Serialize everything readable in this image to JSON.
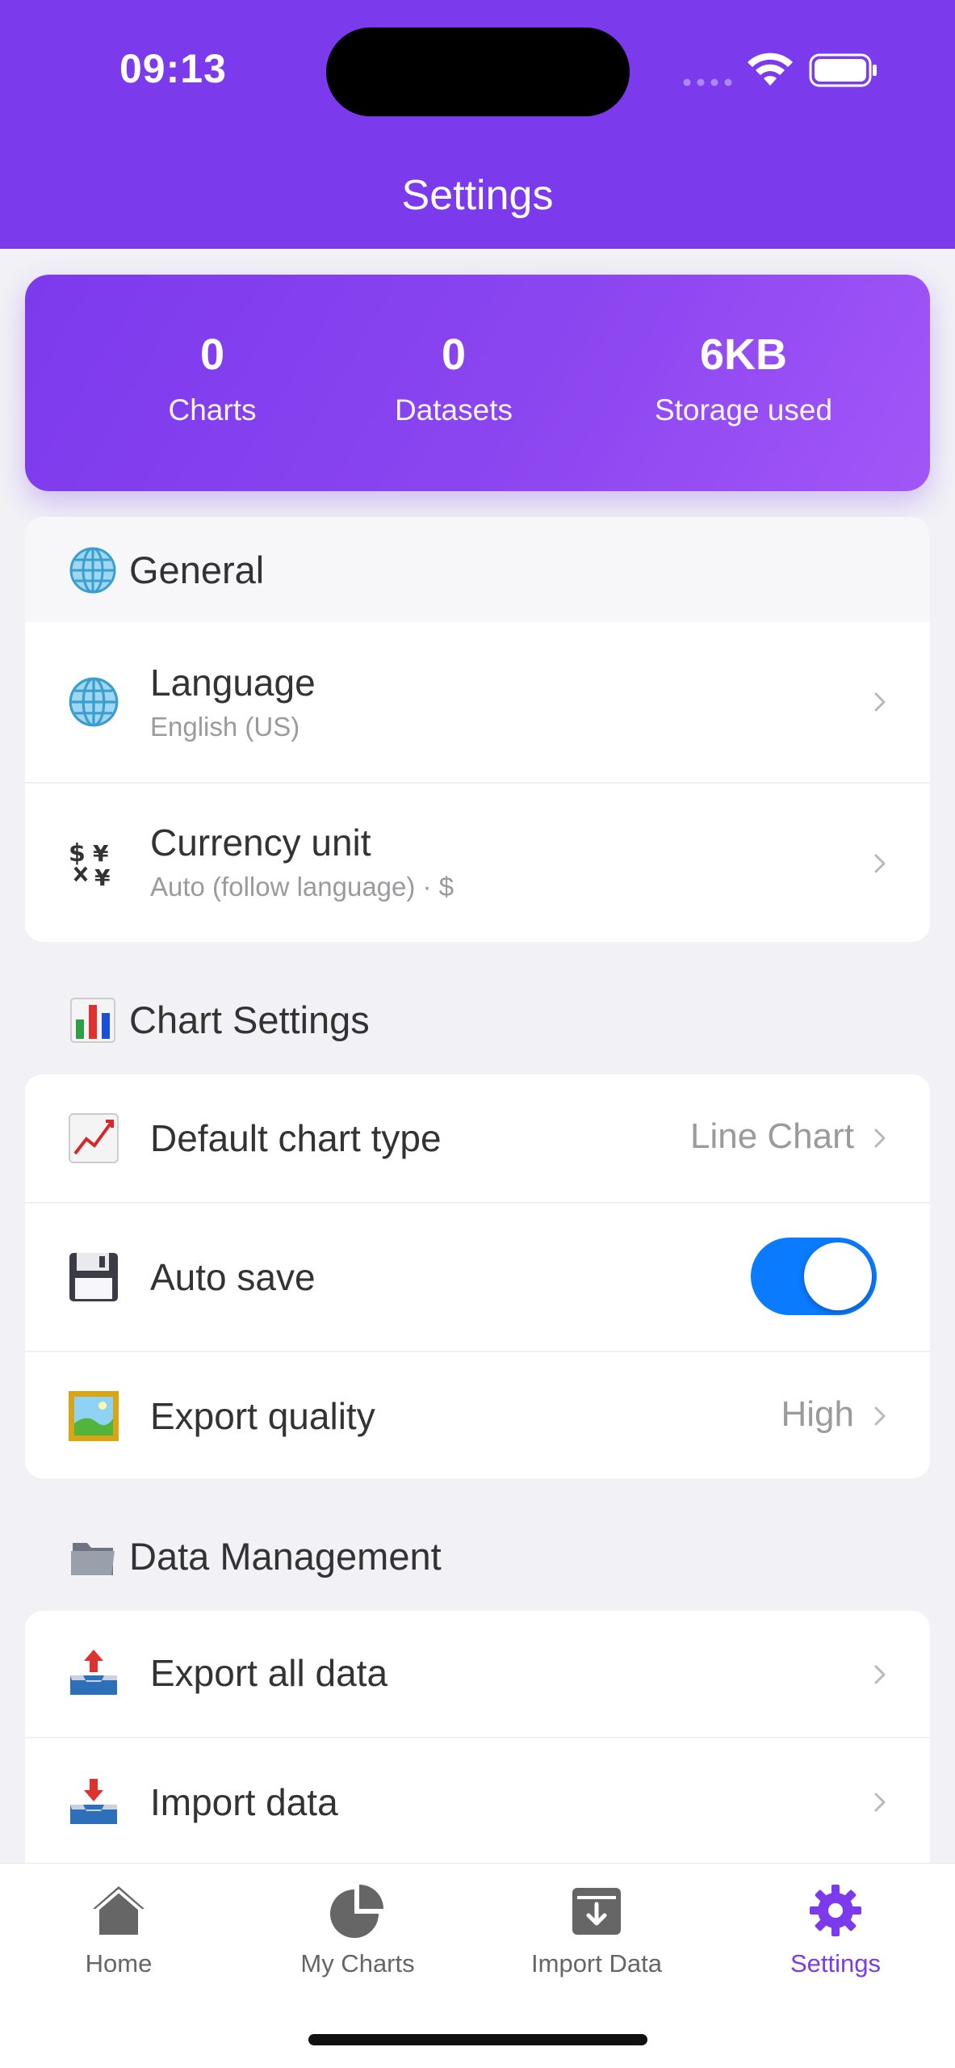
{
  "status_bar": {
    "time": "09:13"
  },
  "header": {
    "title": "Settings"
  },
  "stats": [
    {
      "value": "0",
      "label": "Charts"
    },
    {
      "value": "0",
      "label": "Datasets"
    },
    {
      "value": "6KB",
      "label": "Storage used"
    }
  ],
  "sections": {
    "general": {
      "title": "General",
      "icon": "globe-icon",
      "rows": {
        "language": {
          "title": "Language",
          "subtitle": "English (US)",
          "icon": "globe-icon"
        },
        "currency": {
          "title": "Currency unit",
          "subtitle": "Auto (follow language) · $",
          "icon": "currency-exchange-icon"
        }
      }
    },
    "chart_settings": {
      "title": "Chart Settings",
      "icon": "bar-chart-icon",
      "rows": {
        "default_chart_type": {
          "title": "Default chart type",
          "value": "Line Chart",
          "icon": "line-chart-icon"
        },
        "auto_save": {
          "title": "Auto save",
          "enabled": true,
          "icon": "floppy-disk-icon"
        },
        "export_quality": {
          "title": "Export quality",
          "value": "High",
          "icon": "framed-picture-icon"
        }
      }
    },
    "data_management": {
      "title": "Data Management",
      "icon": "folder-icon",
      "rows": {
        "export_all": {
          "title": "Export all data",
          "icon": "outbox-tray-icon"
        },
        "import": {
          "title": "Import data",
          "icon": "inbox-tray-icon"
        }
      }
    }
  },
  "tabbar": {
    "items": [
      {
        "label": "Home",
        "icon": "home-icon",
        "active": false
      },
      {
        "label": "My Charts",
        "icon": "pie-chart-icon",
        "active": false
      },
      {
        "label": "Import Data",
        "icon": "import-box-icon",
        "active": false
      },
      {
        "label": "Settings",
        "icon": "gear-icon",
        "active": true
      }
    ]
  },
  "colors": {
    "primary": "#7c3aed",
    "toggle_on": "#0a7aff",
    "background": "#f1f1f6",
    "secondary_text": "#9a9a9f"
  }
}
